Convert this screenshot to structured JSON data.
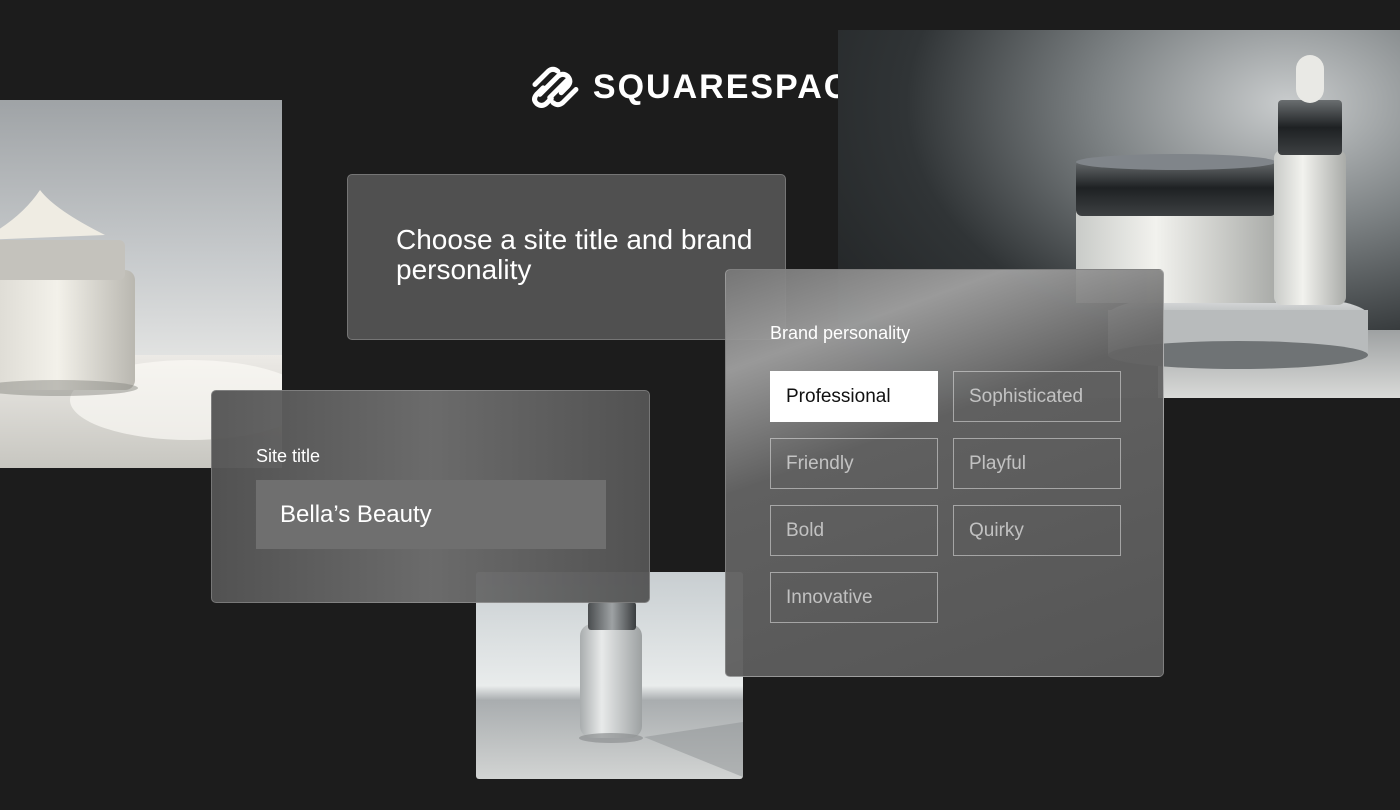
{
  "brand": {
    "logo_text": "SQUARESPACE",
    "logo_icon": "squarespace-logo-icon"
  },
  "heading": {
    "text": "Choose a site title and brand personality"
  },
  "site_title": {
    "label": "Site title",
    "value": "Bella’s Beauty"
  },
  "brand_personality": {
    "label": "Brand personality",
    "selected": "Professional",
    "options": [
      "Professional",
      "Sophisticated",
      "Friendly",
      "Playful",
      "Bold",
      "Quirky",
      "Innovative"
    ]
  },
  "colors": {
    "background": "#1c1c1c",
    "card": "#5c5c5c",
    "selected_chip": "#ffffff"
  }
}
